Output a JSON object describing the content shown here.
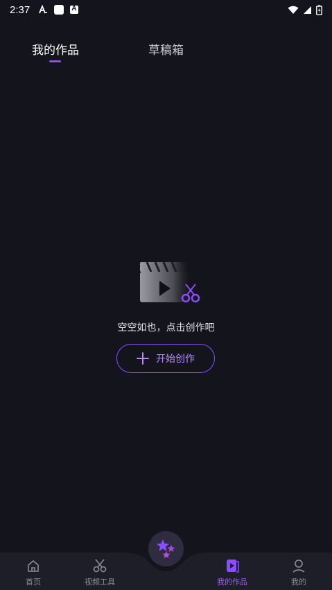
{
  "status_bar": {
    "time": "2:37"
  },
  "tabs": [
    {
      "label": "我的作品",
      "active": true
    },
    {
      "label": "草稿箱",
      "active": false
    }
  ],
  "empty_state": {
    "message": "空空如也，点击创作吧",
    "button_label": "开始创作"
  },
  "bottom_nav": {
    "items": [
      {
        "label": "首页",
        "icon": "home-icon",
        "active": false
      },
      {
        "label": "视频工具",
        "icon": "scissors-icon",
        "active": false
      },
      {
        "label": "我的作品",
        "icon": "video-works-icon",
        "active": true
      },
      {
        "label": "我的",
        "icon": "person-icon",
        "active": false
      }
    ],
    "center_button_icon": "stars-icon"
  },
  "colors": {
    "background": "#14151c",
    "accent": "#8a4dff",
    "nav_background": "#1d1e27"
  }
}
